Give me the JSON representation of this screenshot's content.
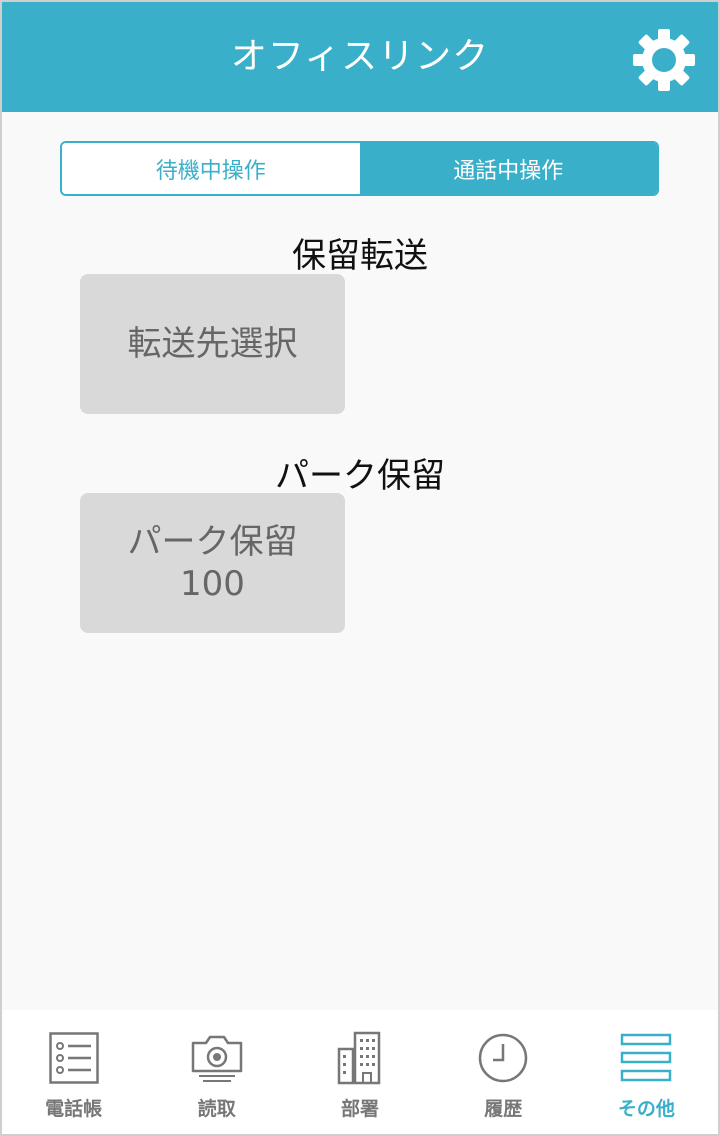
{
  "header": {
    "title": "オフィスリンク",
    "settings_icon": "gear-icon"
  },
  "segmented": {
    "tabs": [
      {
        "label": "待機中操作",
        "active": false
      },
      {
        "label": "通話中操作",
        "active": true
      }
    ]
  },
  "sections": [
    {
      "title": "保留転送",
      "button_lines": [
        "転送先選択"
      ]
    },
    {
      "title": "パーク保留",
      "button_lines": [
        "パーク保留",
        "100"
      ]
    }
  ],
  "tabbar": {
    "items": [
      {
        "label": "電話帳",
        "icon": "list-icon",
        "active": false
      },
      {
        "label": "読取",
        "icon": "camera-icon",
        "active": false
      },
      {
        "label": "部署",
        "icon": "building-icon",
        "active": false
      },
      {
        "label": "履歴",
        "icon": "clock-icon",
        "active": false
      },
      {
        "label": "その他",
        "icon": "menu-icon",
        "active": true
      }
    ]
  },
  "colors": {
    "accent": "#3aafc9",
    "button_bg": "#d9d9d9",
    "background": "#f9f9f9"
  }
}
